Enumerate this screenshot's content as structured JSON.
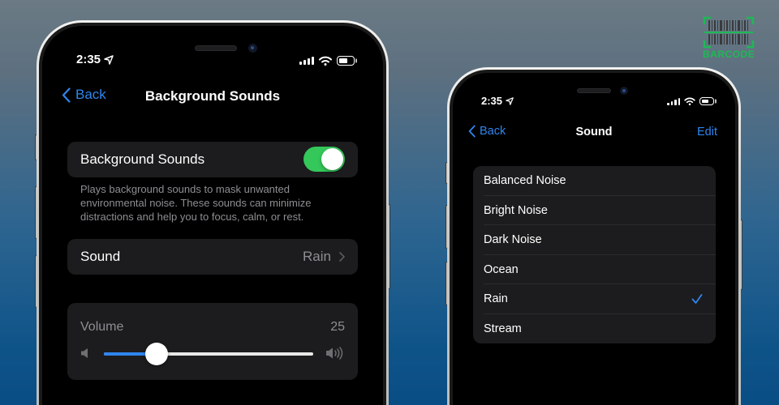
{
  "colors": {
    "accent": "#2f86ef",
    "toggle_on": "#34c759",
    "group_bg": "#1c1c1e",
    "secondary_text": "#8e8e93",
    "logo_green": "#1db954"
  },
  "logo": {
    "text": "BARCODE",
    "icon": "barcode-icon"
  },
  "left_phone": {
    "status_bar": {
      "time": "2:35",
      "location_icon": "location-arrow-icon",
      "signal_icon": "cellular-signal-icon",
      "wifi_icon": "wifi-icon",
      "battery_icon": "battery-icon",
      "battery_level": 0.5
    },
    "nav": {
      "back_label": "Back",
      "back_icon": "chevron-left-icon",
      "title": "Background Sounds"
    },
    "toggle_row": {
      "label": "Background Sounds",
      "enabled": true
    },
    "description": "Plays background sounds to mask unwanted environmental noise. These sounds can minimize distractions and help you to focus, calm, or rest.",
    "sound_row": {
      "label": "Sound",
      "value": "Rain",
      "chevron_icon": "chevron-right-icon"
    },
    "volume": {
      "label": "Volume",
      "value": "25",
      "fraction": 0.25,
      "min_icon": "speaker-low-icon",
      "max_icon": "speaker-high-icon"
    }
  },
  "right_phone": {
    "status_bar": {
      "time": "2:35",
      "location_icon": "location-arrow-icon",
      "signal_icon": "cellular-signal-icon",
      "wifi_icon": "wifi-icon",
      "battery_icon": "battery-icon",
      "battery_level": 0.5
    },
    "nav": {
      "back_label": "Back",
      "back_icon": "chevron-left-icon",
      "title": "Sound",
      "edit_label": "Edit"
    },
    "sounds": [
      {
        "label": "Balanced Noise",
        "selected": false
      },
      {
        "label": "Bright Noise",
        "selected": false
      },
      {
        "label": "Dark Noise",
        "selected": false
      },
      {
        "label": "Ocean",
        "selected": false
      },
      {
        "label": "Rain",
        "selected": true
      },
      {
        "label": "Stream",
        "selected": false
      }
    ],
    "selected_icon": "checkmark-icon"
  }
}
